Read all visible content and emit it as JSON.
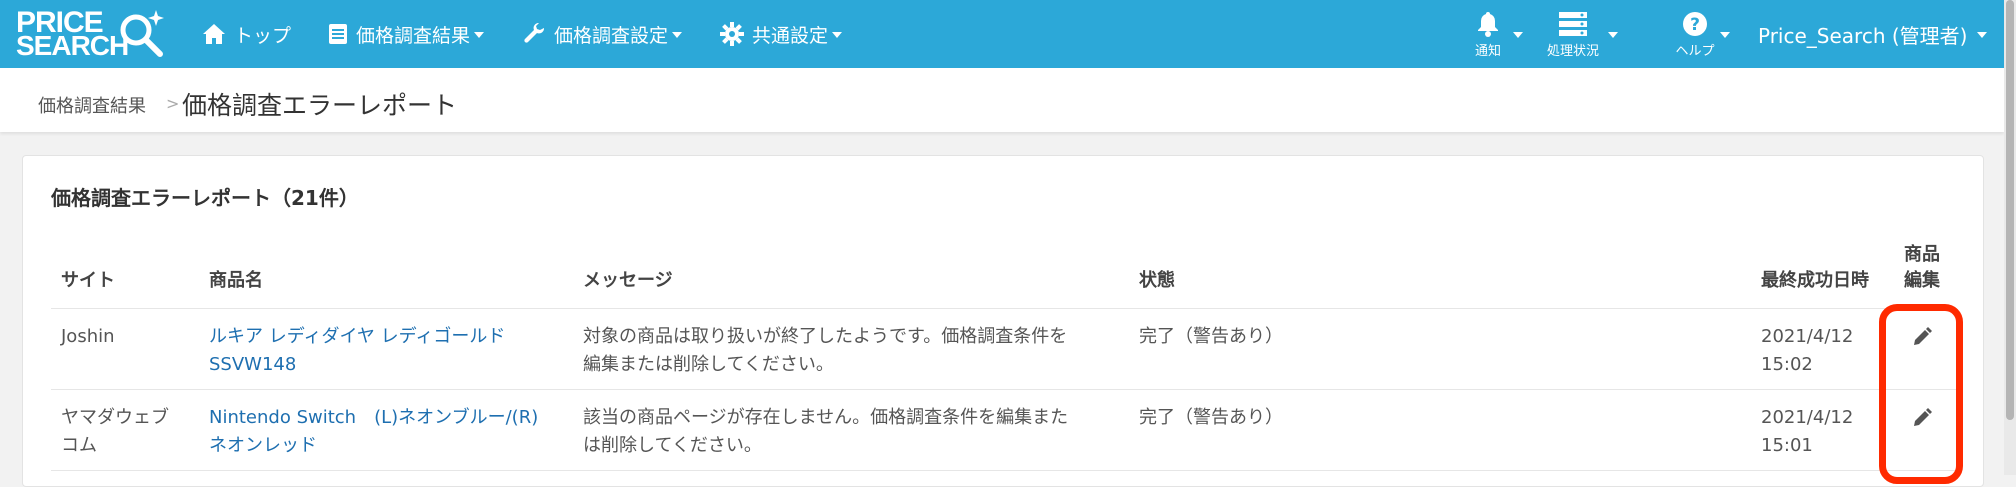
{
  "logo": {
    "line1": "PRICE",
    "line2": "SEARCH"
  },
  "nav": {
    "top": "トップ",
    "results": "価格調査結果",
    "settings": "価格調査設定",
    "common": "共通設定",
    "notify": "通知",
    "processing": "処理状況",
    "help": "ヘルプ",
    "user": "Price_Search (管理者)"
  },
  "breadcrumb": {
    "parent": "価格調査結果",
    "separator": ">",
    "current": "価格調査エラーレポート"
  },
  "panel": {
    "title": "価格調査エラーレポート（21件）"
  },
  "table": {
    "headers": {
      "site": "サイト",
      "product": "商品名",
      "message": "メッセージ",
      "status": "状態",
      "last_success": "最終成功日時",
      "edit_line1": "商品",
      "edit_line2": "編集"
    },
    "rows": [
      {
        "site": "Joshin",
        "product_line1": "ルキア レディダイヤ レディゴールド",
        "product_line2": "SSVW148",
        "message_line1": "対象の商品は取り扱いが終了したようです。価格調査条件を",
        "message_line2": "編集または削除してください。",
        "status": "完了（警告あり）",
        "date": "2021/4/12",
        "time": "15:02"
      },
      {
        "site_line1": "ヤマダウェブ",
        "site_line2": "コム",
        "product_line1": "Nintendo Switch　(L)ネオンブルー/(R)",
        "product_line2": "ネオンレッド",
        "message_line1": "該当の商品ページが存在しません。価格調査条件を編集また",
        "message_line2": "は削除してください。",
        "status": "完了（警告あり）",
        "date": "2021/4/12",
        "time": "15:01"
      }
    ]
  },
  "colors": {
    "navbar": "#2ca8d8",
    "link": "#1e6fb0",
    "highlight": "#ff2a00"
  },
  "icons": [
    "home-icon",
    "list-icon",
    "wrench-icon",
    "gear-icon",
    "bell-icon",
    "server-icon",
    "help-icon",
    "pencil-icon"
  ]
}
